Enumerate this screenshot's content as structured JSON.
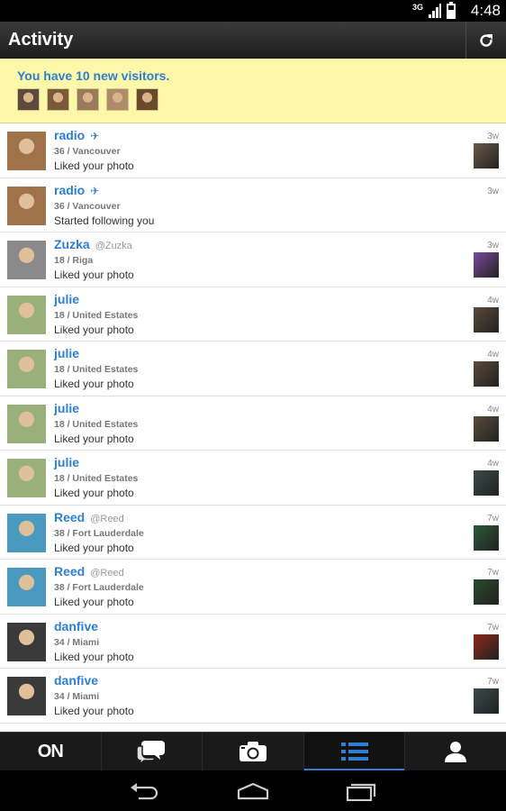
{
  "status_bar": {
    "network": "3G",
    "time": "4:48"
  },
  "action_bar": {
    "title": "Activity",
    "refresh_icon": "refresh-icon"
  },
  "visitors_banner": {
    "text": "You have 10 new visitors.",
    "thumbs": [
      "#5c4a3a",
      "#7a5a3a",
      "#9a7a5a",
      "#b08a6a",
      "#6a4a2a"
    ]
  },
  "activities": [
    {
      "name": "radio",
      "verified": true,
      "handle": "",
      "meta": "36 / Vancouver",
      "action": "Liked your photo",
      "time": "3w",
      "avatar_color": "#a0724a",
      "thumb_color": "#6b5a4a"
    },
    {
      "name": "radio",
      "verified": true,
      "handle": "",
      "meta": "36 / Vancouver",
      "action": "Started following you",
      "time": "3w",
      "avatar_color": "#a0724a",
      "thumb_color": ""
    },
    {
      "name": "Zuzka",
      "verified": false,
      "handle": "@Zuzka",
      "meta": "18 / Riga",
      "action": "Liked your photo",
      "time": "3w",
      "avatar_color": "#8a8a8a",
      "thumb_color": "#7a4a9a"
    },
    {
      "name": "julie",
      "verified": false,
      "handle": "",
      "meta": "18 / United Estates",
      "action": "Liked your photo",
      "time": "4w",
      "avatar_color": "#9ab07a",
      "thumb_color": "#5a4a3a"
    },
    {
      "name": "julie",
      "verified": false,
      "handle": "",
      "meta": "18 / United Estates",
      "action": "Liked your photo",
      "time": "4w",
      "avatar_color": "#9ab07a",
      "thumb_color": "#5a4a3a"
    },
    {
      "name": "julie",
      "verified": false,
      "handle": "",
      "meta": "18 / United Estates",
      "action": "Liked your photo",
      "time": "4w",
      "avatar_color": "#9ab07a",
      "thumb_color": "#5a4a3a"
    },
    {
      "name": "julie",
      "verified": false,
      "handle": "",
      "meta": "18 / United Estates",
      "action": "Liked your photo",
      "time": "4w",
      "avatar_color": "#9ab07a",
      "thumb_color": "#3a4a4a"
    },
    {
      "name": "Reed",
      "verified": false,
      "handle": "@Reed",
      "meta": "38 / Fort Lauderdale",
      "action": "Liked your photo",
      "time": "7w",
      "avatar_color": "#4a9ac0",
      "thumb_color": "#2a5a3a"
    },
    {
      "name": "Reed",
      "verified": false,
      "handle": "@Reed",
      "meta": "38 / Fort Lauderdale",
      "action": "Liked your photo",
      "time": "7w",
      "avatar_color": "#4a9ac0",
      "thumb_color": "#2a4a2a"
    },
    {
      "name": "danfive",
      "verified": false,
      "handle": "",
      "meta": "34 / Miami",
      "action": "Liked your photo",
      "time": "7w",
      "avatar_color": "#3a3a3a",
      "thumb_color": "#8a2a1a"
    },
    {
      "name": "danfive",
      "verified": false,
      "handle": "",
      "meta": "34 / Miami",
      "action": "Liked your photo",
      "time": "7w",
      "avatar_color": "#3a3a3a",
      "thumb_color": "#3a4a4a"
    },
    {
      "name": "",
      "verified": false,
      "handle": "",
      "meta": "",
      "action": "",
      "time": "",
      "avatar_color": "#2a2a2a",
      "thumb_color": ""
    }
  ],
  "tabs": [
    {
      "id": "on",
      "label": "ON",
      "icon": "on-logo",
      "active": false
    },
    {
      "id": "chat",
      "icon": "chat-bubbles-icon",
      "active": false
    },
    {
      "id": "camera",
      "icon": "camera-icon",
      "active": false
    },
    {
      "id": "activity",
      "icon": "list-icon",
      "active": true
    },
    {
      "id": "profile",
      "icon": "person-icon",
      "active": false
    }
  ],
  "nav_bar": {
    "back_icon": "back-icon",
    "home_icon": "home-icon",
    "recents_icon": "recents-icon"
  },
  "colors": {
    "accent": "#2c7fd3",
    "banner_bg": "#fdf7a9"
  }
}
